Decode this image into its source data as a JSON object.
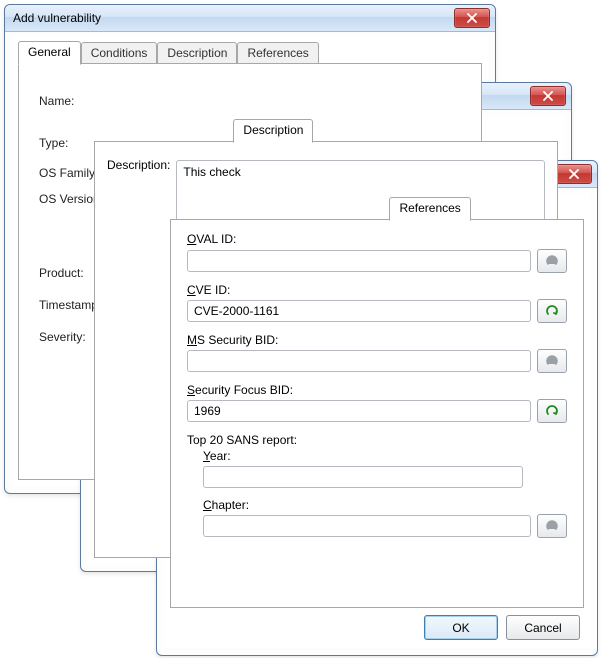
{
  "dialog": {
    "title": "Add vulnerability"
  },
  "tabs": {
    "general": "General",
    "conditions": "Conditions",
    "description": "Description",
    "references": "References"
  },
  "generalTab": {
    "name_label": "Name:",
    "type_label": "Type:",
    "os_family_label": "OS Family:",
    "os_version_label": "OS Version:",
    "product_label": "Product:",
    "timestamp_label": "Timestamp:",
    "severity_label": "Severity:"
  },
  "descriptionTab": {
    "desc_label": "Description:",
    "desc_value": "This check"
  },
  "referencesTab": {
    "oval_label": "OVAL ID:",
    "oval_value": "",
    "cve_label": "CVE ID:",
    "cve_value": "CVE-2000-1161",
    "ms_label": "MS Security BID:",
    "ms_value": "",
    "sf_label": "Security Focus BID:",
    "sf_value": "1969",
    "sans_label": "Top 20 SANS report:",
    "year_label": "Year:",
    "year_value": "",
    "chapter_label": "Chapter:",
    "chapter_value": ""
  },
  "buttons": {
    "ok": "OK",
    "cancel": "Cancel"
  }
}
